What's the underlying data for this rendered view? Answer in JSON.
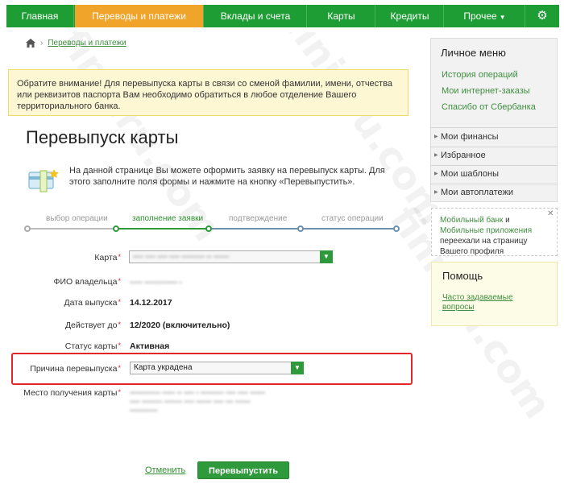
{
  "nav": {
    "items": [
      {
        "label": "Главная"
      },
      {
        "label": "Переводы и платежи"
      },
      {
        "label": "Вклады и счета"
      },
      {
        "label": "Карты"
      },
      {
        "label": "Кредиты"
      },
      {
        "label": "Прочее"
      }
    ],
    "settings_icon": "gear-icon"
  },
  "breadcrumb": {
    "home_icon": "home-icon",
    "link": "Переводы и платежи"
  },
  "notice": "Обратите внимание! Для перевыпуска карты в связи со сменой фамилии, имени, отчества или реквизитов паспорта Вам необходимо обратиться в любое отделение Вашего территориального банка.",
  "page_title": "Перевыпуск карты",
  "intro": "На данной странице Вы можете оформить заявку на перевыпуск карты. Для этого заполните поля формы и нажмите на кнопку «Перевыпустить».",
  "steps": [
    "выбор операции",
    "заполнение заявки",
    "подтверждение",
    "статус операции"
  ],
  "form": {
    "card_label": "Карта",
    "card_value": "•••• •••• •••• ••••  ••••••••• ••  ••••••",
    "owner_label": "ФИО владельца",
    "owner_value": "••••• ••••••••••••• •",
    "issue_label": "Дата выпуска",
    "issue_value": "14.12.2017",
    "valid_label": "Действует до",
    "valid_value": "12/2020 (включительно)",
    "status_label": "Статус карты",
    "status_value": "Активная",
    "reason_label": "Причина перевыпуска",
    "reason_value": "Карта украдена",
    "place_label": "Место получения карты",
    "place_value_1": "•••••••••••• ••••• •• •••• • ••••••••• •••• •••• ••••••",
    "place_value_2": "•••• •••••••• ••••••• •••• •••••• •••• ••• ••••••",
    "place_value_3": "•••••••••••"
  },
  "buttons": {
    "cancel": "Отменить",
    "submit": "Перевыпустить"
  },
  "sidebar": {
    "title": "Личное меню",
    "links": [
      "История операций",
      "Мои интернет-заказы",
      "Спасибо от Сбербанка"
    ],
    "sections": [
      "Мои финансы",
      "Избранное",
      "Мои шаблоны",
      "Мои автоплатежи"
    ]
  },
  "mobile": {
    "link1": "Мобильный банк",
    "and": " и ",
    "link2": "Мобильные приложения",
    "rest": " переехали на страницу Вашего профиля"
  },
  "help": {
    "title": "Помощь",
    "link": "Часто задаваемые вопросы"
  },
  "colors": {
    "brand_green": "#1f9d35",
    "active_tab": "#f0a42a",
    "highlight": "#e3262a"
  }
}
